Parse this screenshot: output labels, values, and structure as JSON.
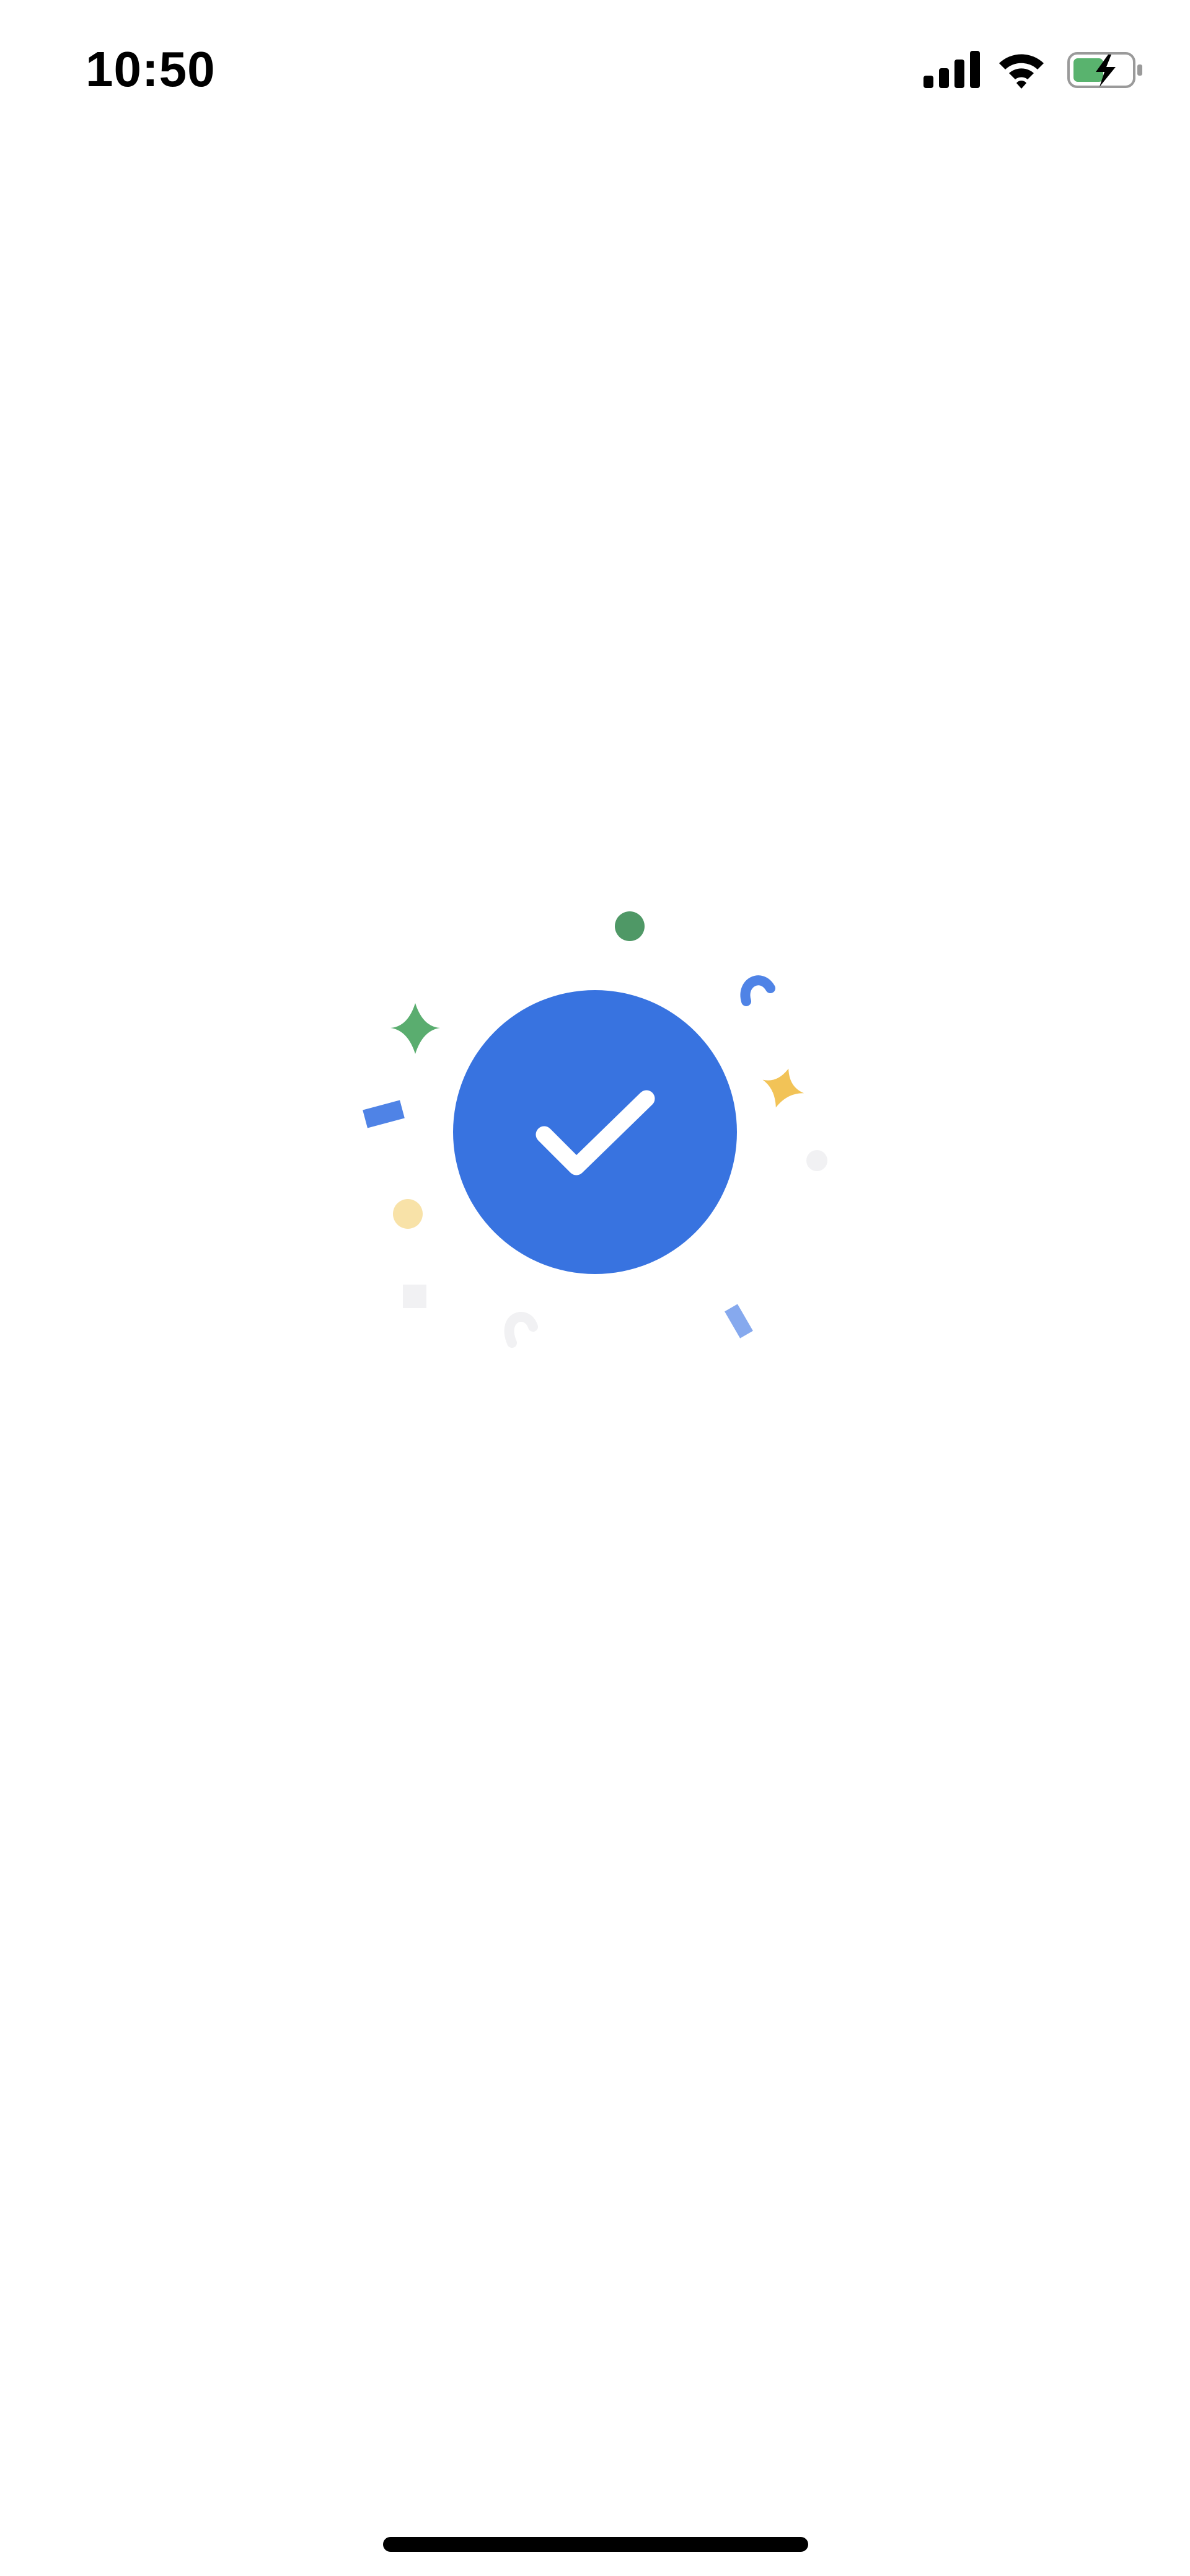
{
  "status_bar": {
    "time": "10:50",
    "icons": [
      "cellular-signal-icon",
      "wifi-icon",
      "battery-charging-icon"
    ]
  },
  "confirmation": {
    "icon": "checkmark-icon",
    "colors": {
      "circle": "#3873e0",
      "check": "#ffffff"
    }
  },
  "confetti": {
    "colors": {
      "green_dark": "#4f9866",
      "green": "#5aad6f",
      "blue": "#4f83e6",
      "blue_light": "#86a9ee",
      "yellow": "#f2c357",
      "yellow_light": "#f8e2a8",
      "gray_light": "#f1f1f3"
    }
  },
  "home_indicator": {
    "color": "#000000"
  }
}
